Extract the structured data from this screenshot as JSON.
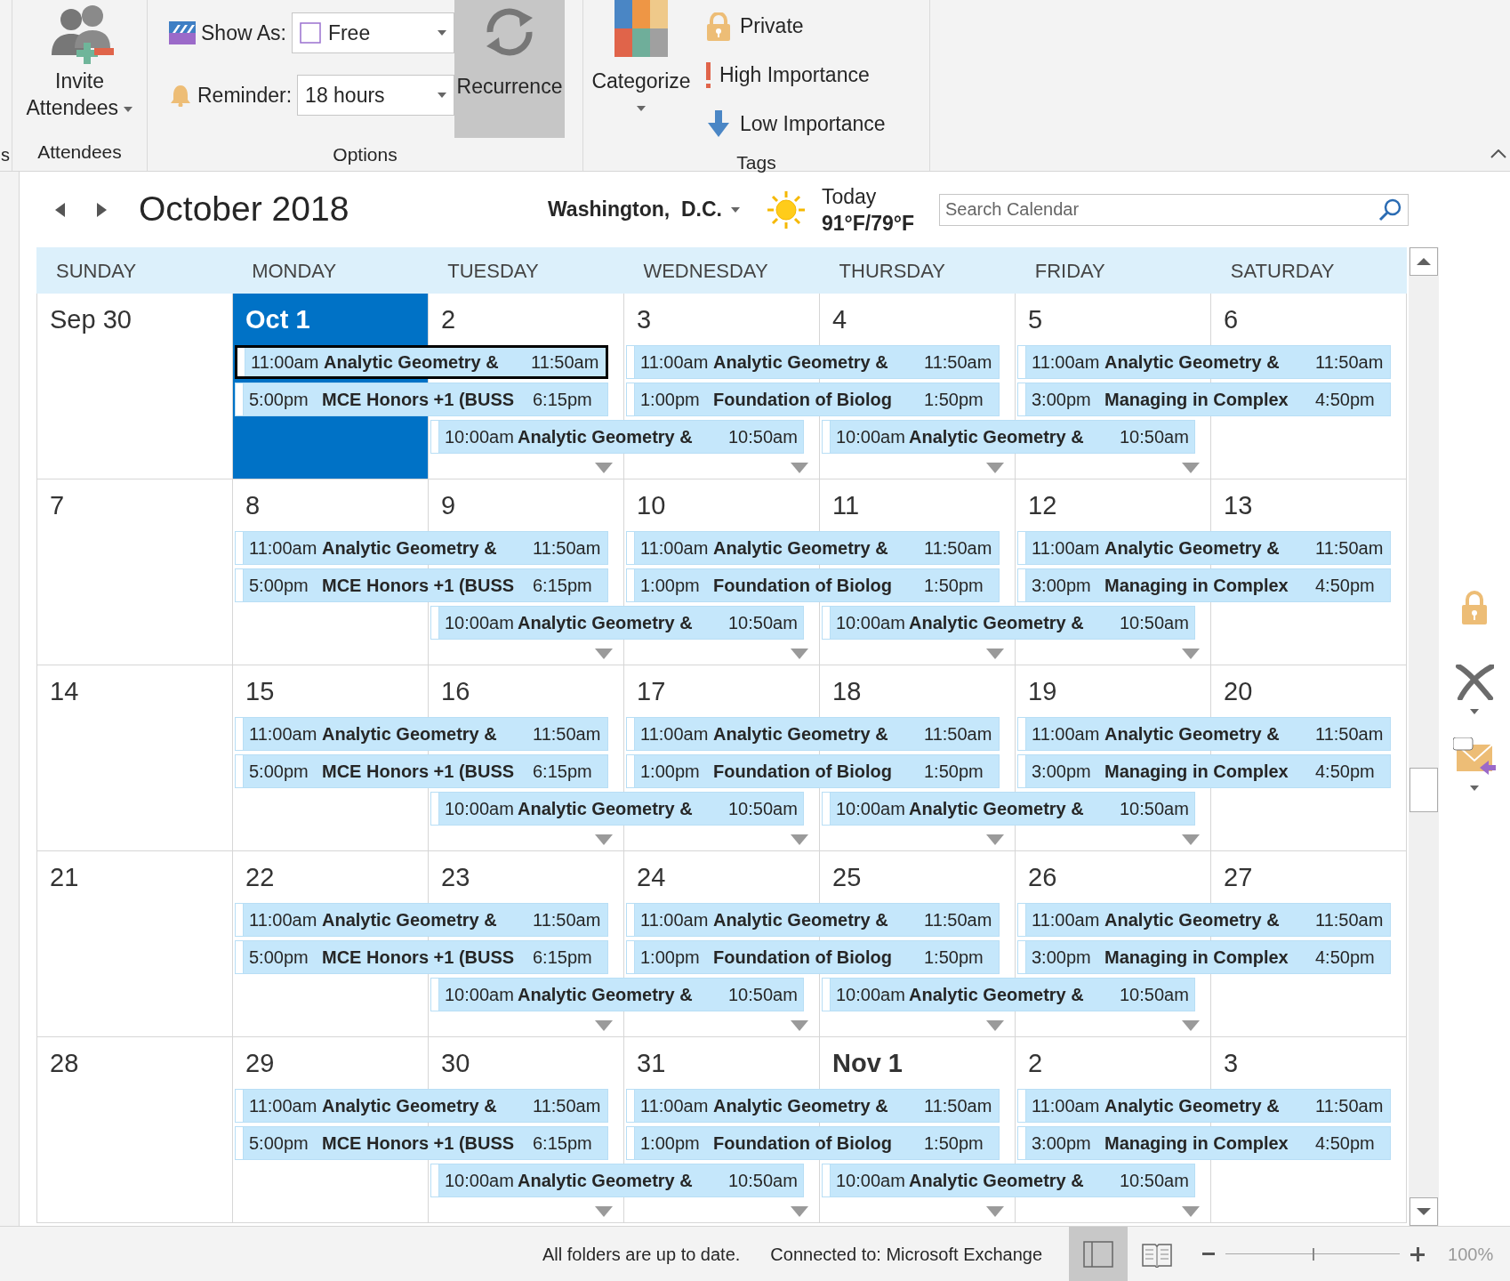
{
  "ribbon": {
    "cut_group_label": "s",
    "attendees": {
      "button": "Invite Attendees",
      "group_label": "Attendees"
    },
    "options": {
      "show_as": {
        "label": "Show As:",
        "value": "Free"
      },
      "reminder": {
        "label": "Reminder:",
        "value": "18 hours"
      },
      "recurrence": {
        "label": "Recurrence",
        "active": true
      },
      "group_label": "Options"
    },
    "tags": {
      "categorize": "Categorize",
      "items": [
        {
          "kind": "private",
          "label": "Private"
        },
        {
          "kind": "high",
          "label": "High Importance"
        },
        {
          "kind": "low",
          "label": "Low Importance"
        }
      ],
      "group_label": "Tags"
    }
  },
  "calendar_header": {
    "title": "October 2018",
    "location": "Washington,  D.C.",
    "weather": {
      "day": "Today",
      "temps": "91°F/79°F"
    },
    "search": {
      "placeholder": "Search Calendar"
    }
  },
  "weekdays": [
    "SUNDAY",
    "MONDAY",
    "TUESDAY",
    "WEDNESDAY",
    "THURSDAY",
    "FRIDAY",
    "SATURDAY"
  ],
  "weeks": [
    {
      "days": [
        {
          "label": "Sep 30",
          "today": false,
          "bold": false,
          "more": false
        },
        {
          "label": "Oct 1",
          "today": true,
          "bold": true,
          "more": false,
          "events": [
            {
              "start": "11:00am",
              "title": "Analytic Geometry &",
              "end": "11:50am",
              "selected": true
            },
            {
              "start": "5:00pm",
              "title": "MCE Honors +1 (BUSS",
              "end": "6:15pm",
              "selected": false
            }
          ]
        },
        {
          "label": "2",
          "today": false,
          "bold": false,
          "more": true,
          "events": [
            {
              "start": "10:00am",
              "title": "Analytic Geometry &",
              "end": "10:50am",
              "selected": false
            }
          ]
        },
        {
          "label": "3",
          "today": false,
          "bold": false,
          "more": true,
          "events": [
            {
              "start": "11:00am",
              "title": "Analytic Geometry &",
              "end": "11:50am",
              "selected": false
            },
            {
              "start": "1:00pm",
              "title": "Foundation of Biolog",
              "end": "1:50pm",
              "selected": false
            }
          ]
        },
        {
          "label": "4",
          "today": false,
          "bold": false,
          "more": true,
          "events": [
            {
              "start": "10:00am",
              "title": "Analytic Geometry &",
              "end": "10:50am",
              "selected": false
            }
          ]
        },
        {
          "label": "5",
          "today": false,
          "bold": false,
          "more": true,
          "events": [
            {
              "start": "11:00am",
              "title": "Analytic Geometry &",
              "end": "11:50am",
              "selected": false
            },
            {
              "start": "3:00pm",
              "title": "Managing in Complex",
              "end": "4:50pm",
              "selected": false
            }
          ]
        },
        {
          "label": "6",
          "today": false,
          "bold": false,
          "more": false
        }
      ]
    },
    {
      "days": [
        {
          "label": "7",
          "today": false,
          "bold": false,
          "more": false
        },
        {
          "label": "8",
          "today": false,
          "bold": false,
          "more": false,
          "events": [
            {
              "start": "11:00am",
              "title": "Analytic Geometry &",
              "end": "11:50am",
              "selected": false
            },
            {
              "start": "5:00pm",
              "title": "MCE Honors +1 (BUSS",
              "end": "6:15pm",
              "selected": false
            }
          ]
        },
        {
          "label": "9",
          "today": false,
          "bold": false,
          "more": true,
          "events": [
            {
              "start": "10:00am",
              "title": "Analytic Geometry &",
              "end": "10:50am",
              "selected": false
            }
          ]
        },
        {
          "label": "10",
          "today": false,
          "bold": false,
          "more": true,
          "events": [
            {
              "start": "11:00am",
              "title": "Analytic Geometry &",
              "end": "11:50am",
              "selected": false
            },
            {
              "start": "1:00pm",
              "title": "Foundation of Biolog",
              "end": "1:50pm",
              "selected": false
            }
          ]
        },
        {
          "label": "11",
          "today": false,
          "bold": false,
          "more": true,
          "events": [
            {
              "start": "10:00am",
              "title": "Analytic Geometry &",
              "end": "10:50am",
              "selected": false
            }
          ]
        },
        {
          "label": "12",
          "today": false,
          "bold": false,
          "more": true,
          "events": [
            {
              "start": "11:00am",
              "title": "Analytic Geometry &",
              "end": "11:50am",
              "selected": false
            },
            {
              "start": "3:00pm",
              "title": "Managing in Complex",
              "end": "4:50pm",
              "selected": false
            }
          ]
        },
        {
          "label": "13",
          "today": false,
          "bold": false,
          "more": false
        }
      ]
    },
    {
      "days": [
        {
          "label": "14",
          "today": false,
          "bold": false,
          "more": false
        },
        {
          "label": "15",
          "today": false,
          "bold": false,
          "more": false,
          "events": [
            {
              "start": "11:00am",
              "title": "Analytic Geometry &",
              "end": "11:50am",
              "selected": false
            },
            {
              "start": "5:00pm",
              "title": "MCE Honors +1 (BUSS",
              "end": "6:15pm",
              "selected": false
            }
          ]
        },
        {
          "label": "16",
          "today": false,
          "bold": false,
          "more": true,
          "events": [
            {
              "start": "10:00am",
              "title": "Analytic Geometry &",
              "end": "10:50am",
              "selected": false
            }
          ]
        },
        {
          "label": "17",
          "today": false,
          "bold": false,
          "more": true,
          "events": [
            {
              "start": "11:00am",
              "title": "Analytic Geometry &",
              "end": "11:50am",
              "selected": false
            },
            {
              "start": "1:00pm",
              "title": "Foundation of Biolog",
              "end": "1:50pm",
              "selected": false
            }
          ]
        },
        {
          "label": "18",
          "today": false,
          "bold": false,
          "more": true,
          "events": [
            {
              "start": "10:00am",
              "title": "Analytic Geometry &",
              "end": "10:50am",
              "selected": false
            }
          ]
        },
        {
          "label": "19",
          "today": false,
          "bold": false,
          "more": true,
          "events": [
            {
              "start": "11:00am",
              "title": "Analytic Geometry &",
              "end": "11:50am",
              "selected": false
            },
            {
              "start": "3:00pm",
              "title": "Managing in Complex",
              "end": "4:50pm",
              "selected": false
            }
          ]
        },
        {
          "label": "20",
          "today": false,
          "bold": false,
          "more": false
        }
      ]
    },
    {
      "days": [
        {
          "label": "21",
          "today": false,
          "bold": false,
          "more": false
        },
        {
          "label": "22",
          "today": false,
          "bold": false,
          "more": false,
          "events": [
            {
              "start": "11:00am",
              "title": "Analytic Geometry &",
              "end": "11:50am",
              "selected": false
            },
            {
              "start": "5:00pm",
              "title": "MCE Honors +1 (BUSS",
              "end": "6:15pm",
              "selected": false
            }
          ]
        },
        {
          "label": "23",
          "today": false,
          "bold": false,
          "more": true,
          "events": [
            {
              "start": "10:00am",
              "title": "Analytic Geometry &",
              "end": "10:50am",
              "selected": false
            }
          ]
        },
        {
          "label": "24",
          "today": false,
          "bold": false,
          "more": true,
          "events": [
            {
              "start": "11:00am",
              "title": "Analytic Geometry &",
              "end": "11:50am",
              "selected": false
            },
            {
              "start": "1:00pm",
              "title": "Foundation of Biolog",
              "end": "1:50pm",
              "selected": false
            }
          ]
        },
        {
          "label": "25",
          "today": false,
          "bold": false,
          "more": true,
          "events": [
            {
              "start": "10:00am",
              "title": "Analytic Geometry &",
              "end": "10:50am",
              "selected": false
            }
          ]
        },
        {
          "label": "26",
          "today": false,
          "bold": false,
          "more": true,
          "events": [
            {
              "start": "11:00am",
              "title": "Analytic Geometry &",
              "end": "11:50am",
              "selected": false
            },
            {
              "start": "3:00pm",
              "title": "Managing in Complex",
              "end": "4:50pm",
              "selected": false
            }
          ]
        },
        {
          "label": "27",
          "today": false,
          "bold": false,
          "more": false
        }
      ]
    },
    {
      "days": [
        {
          "label": "28",
          "today": false,
          "bold": false,
          "more": false
        },
        {
          "label": "29",
          "today": false,
          "bold": false,
          "more": false,
          "events": [
            {
              "start": "11:00am",
              "title": "Analytic Geometry &",
              "end": "11:50am",
              "selected": false
            },
            {
              "start": "5:00pm",
              "title": "MCE Honors +1 (BUSS",
              "end": "6:15pm",
              "selected": false
            }
          ]
        },
        {
          "label": "30",
          "today": false,
          "bold": false,
          "more": true,
          "events": [
            {
              "start": "10:00am",
              "title": "Analytic Geometry &",
              "end": "10:50am",
              "selected": false
            }
          ]
        },
        {
          "label": "31",
          "today": false,
          "bold": false,
          "more": true,
          "events": [
            {
              "start": "11:00am",
              "title": "Analytic Geometry &",
              "end": "11:50am",
              "selected": false
            },
            {
              "start": "1:00pm",
              "title": "Foundation of Biolog",
              "end": "1:50pm",
              "selected": false
            }
          ]
        },
        {
          "label": "Nov 1",
          "today": false,
          "bold": true,
          "more": true,
          "events": [
            {
              "start": "10:00am",
              "title": "Analytic Geometry &",
              "end": "10:50am",
              "selected": false
            }
          ]
        },
        {
          "label": "2",
          "today": false,
          "bold": false,
          "more": true,
          "events": [
            {
              "start": "11:00am",
              "title": "Analytic Geometry &",
              "end": "11:50am",
              "selected": false
            },
            {
              "start": "3:00pm",
              "title": "Managing in Complex",
              "end": "4:50pm",
              "selected": false
            }
          ]
        },
        {
          "label": "3",
          "today": false,
          "bold": false,
          "more": false
        }
      ]
    }
  ],
  "status_bar": {
    "messages": [
      "All folders are up to date.",
      "Connected to: Microsoft Exchange"
    ],
    "views": [
      {
        "kind": "normal",
        "selected": true
      },
      {
        "kind": "reading",
        "selected": false
      }
    ],
    "zoom": {
      "level": 0.5,
      "reading": "100%"
    }
  }
}
